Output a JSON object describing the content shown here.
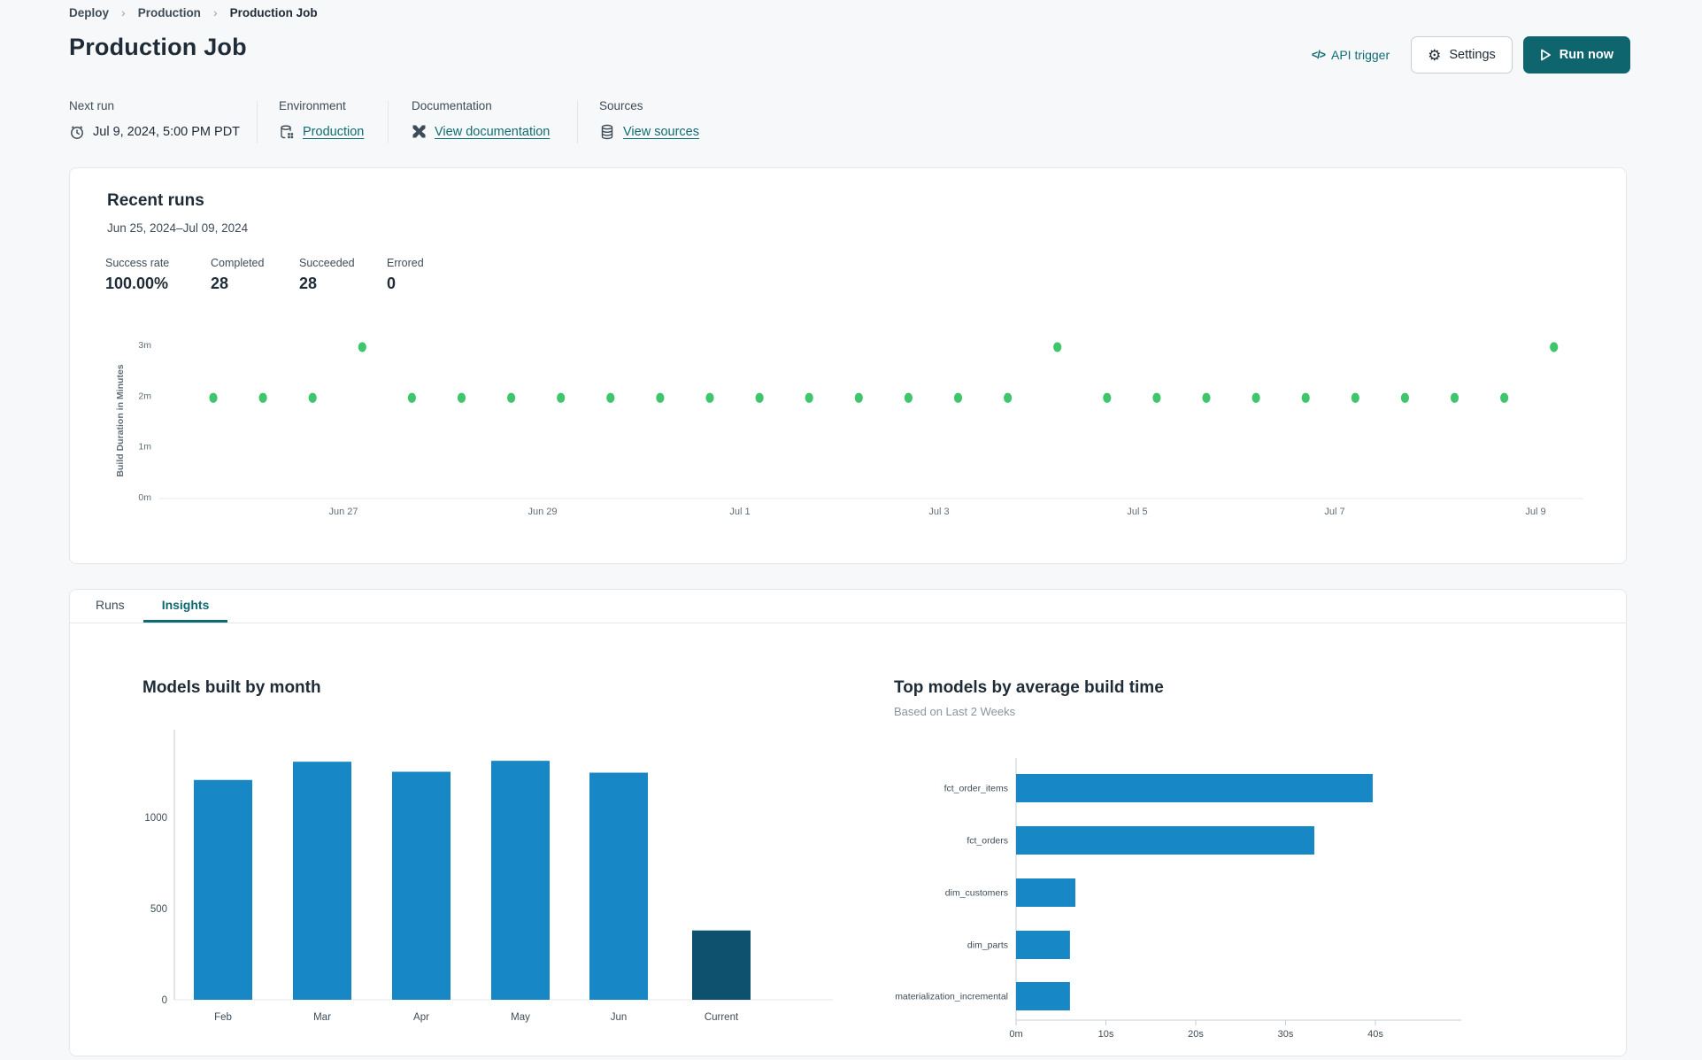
{
  "breadcrumb": {
    "items": [
      "Deploy",
      "Production",
      "Production Job"
    ]
  },
  "header": {
    "title": "Production Job",
    "api_trigger_label": "API trigger",
    "settings_label": "Settings",
    "run_now_label": "Run now"
  },
  "meta": {
    "columns": [
      {
        "label": "Next run",
        "value": "Jul 9, 2024, 5:00 PM PDT",
        "icon": "clock-icon",
        "is_link": false
      },
      {
        "label": "Environment",
        "value": "Production",
        "icon": "environment-icon",
        "is_link": true
      },
      {
        "label": "Documentation",
        "value": "View documentation",
        "icon": "dbt-docs-icon",
        "is_link": true
      },
      {
        "label": "Sources",
        "value": "View sources",
        "icon": "database-icon",
        "is_link": true
      }
    ]
  },
  "recent_runs": {
    "title": "Recent runs",
    "date_range": "Jun 25, 2024–Jul 09, 2024",
    "stats": [
      {
        "label": "Success rate",
        "value": "100.00%"
      },
      {
        "label": "Completed",
        "value": "28"
      },
      {
        "label": "Succeeded",
        "value": "28"
      },
      {
        "label": "Errored",
        "value": "0"
      }
    ]
  },
  "tabs": [
    {
      "label": "Runs",
      "active": false
    },
    {
      "label": "Insights",
      "active": true
    }
  ],
  "colors": {
    "accent_teal": "#0e6a72",
    "button_teal": "#0e656e",
    "dot_green": "#3fc56c",
    "bar_blue": "#1787c6",
    "bar_dark_blue": "#0d516f",
    "axis_line": "#c6ccd2",
    "grid_light": "#e3e7ea",
    "axis_text": "#5f6e78"
  },
  "chart_data": [
    {
      "type": "scatter",
      "name": "build-duration-scatter",
      "ylabel": "Build Duration in Minutes",
      "y_ticks": [
        {
          "label": "0m",
          "minutes": 0
        },
        {
          "label": "1m",
          "minutes": 1
        },
        {
          "label": "2m",
          "minutes": 2
        },
        {
          "label": "3m",
          "minutes": 3
        }
      ],
      "x_ticks": [
        "Jun 27",
        "Jun 29",
        "Jul 1",
        "Jul 3",
        "Jul 5",
        "Jul 7",
        "Jul 9"
      ],
      "ylim_minutes": [
        0,
        3.3
      ],
      "points_minutes": [
        1.95,
        1.95,
        1.95,
        2.95,
        1.95,
        1.95,
        1.95,
        1.95,
        1.95,
        1.95,
        1.95,
        1.95,
        1.95,
        1.95,
        1.95,
        1.95,
        1.95,
        2.95,
        1.95,
        1.95,
        1.95,
        1.95,
        1.95,
        1.95,
        1.95,
        1.95,
        1.95,
        2.95
      ],
      "point_color": "#3fc56c",
      "grid": false
    },
    {
      "type": "bar",
      "title": "Models built by month",
      "categories": [
        "Feb",
        "Mar",
        "Apr",
        "May",
        "Jun",
        "Current"
      ],
      "values": [
        1205,
        1305,
        1250,
        1310,
        1245,
        380
      ],
      "y_ticks": [
        0,
        500,
        1000
      ],
      "ylim": [
        0,
        1430
      ],
      "bar_color": "#1787c6",
      "highlight_color": "#0d516f",
      "highlight_index": 5,
      "grid": false,
      "legend": "none"
    },
    {
      "type": "bar",
      "orientation": "horizontal",
      "title": "Top models by average build time",
      "subtitle": "Based on Last 2 Weeks",
      "categories": [
        "fct_order_items",
        "fct_orders",
        "dim_customers",
        "dim_parts",
        "materialization_incremental"
      ],
      "values_seconds": [
        39.7,
        33.2,
        6.6,
        6.0,
        6.0
      ],
      "x_ticks": [
        {
          "label": "0m",
          "seconds": 0
        },
        {
          "label": "10s",
          "seconds": 10
        },
        {
          "label": "20s",
          "seconds": 20
        },
        {
          "label": "30s",
          "seconds": 30
        },
        {
          "label": "40s",
          "seconds": 40
        }
      ],
      "xlim_seconds": [
        0,
        45
      ],
      "bar_color": "#1787c6",
      "grid": false,
      "legend": "none"
    }
  ]
}
